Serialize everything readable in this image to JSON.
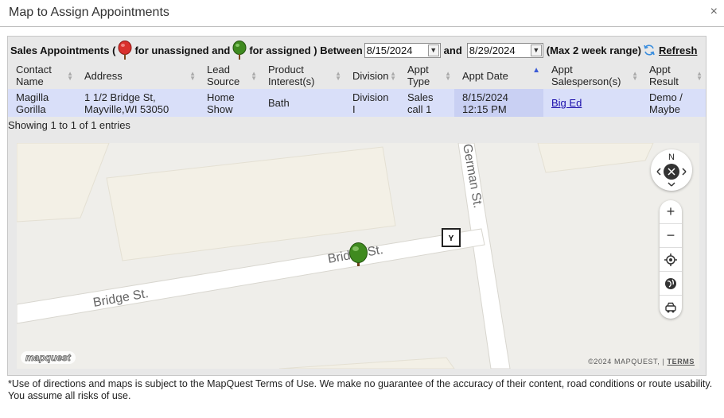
{
  "dialog": {
    "title": "Map to Assign Appointments",
    "close_glyph": "×"
  },
  "toolbar": {
    "label_prefix": "Sales Appointments (",
    "label_unassigned": "for unassigned and",
    "label_assigned": "for assigned ) Between",
    "date_from": "8/15/2024",
    "and_label": "and",
    "date_to": "8/29/2024",
    "max_range_note": "(Max 2 week range)",
    "refresh_label": "Refresh",
    "unassigned_color": "#d9302c",
    "assigned_color": "#3f8a1f"
  },
  "table": {
    "columns": [
      "Contact Name",
      "Address",
      "Lead Source",
      "Product Interest(s)",
      "Division",
      "Appt Type",
      "Appt Date",
      "Appt Salesperson(s)",
      "Appt Result"
    ],
    "columns_wrapped": [
      [
        "Contact",
        "Name"
      ],
      [
        "Address"
      ],
      [
        "Lead",
        "Source"
      ],
      [
        "Product",
        "Interest(s)"
      ],
      [
        "Division"
      ],
      [
        "Appt",
        "Type"
      ],
      [
        "Appt Date"
      ],
      [
        "Appt",
        "Salesperson(s)"
      ],
      [
        "Appt",
        "Result"
      ]
    ],
    "rows": [
      {
        "contact": [
          "Magilla",
          "Gorilla"
        ],
        "address": [
          "1 1/2 Bridge St,",
          "Mayville,WI 53050"
        ],
        "lead_source": [
          "Home",
          "Show"
        ],
        "product": "Bath",
        "division": [
          "Division",
          "I"
        ],
        "appt_type": [
          "Sales",
          "call 1"
        ],
        "appt_date": [
          "8/15/2024",
          "12:15 PM"
        ],
        "salesperson": "Big Ed",
        "result": [
          "Demo /",
          "Maybe"
        ]
      }
    ],
    "row_bg": "#d9dff9",
    "sorted_bg": "#c9d0f3"
  },
  "showing": "Showing 1 to 1 of 1 entries",
  "map": {
    "streets": [
      "German St.",
      "Bridge St.",
      "Bridge St."
    ],
    "provider_logo": "mapquest",
    "copyright": "©2024 MAPQUEST,  |",
    "terms": "TERMS",
    "compass_north": "N",
    "pointer_label": "Y",
    "zoom_in": "+",
    "zoom_out": "−",
    "road_color": "#ffffff",
    "block_color": "#f3f0e6",
    "ground_color": "#efeeea"
  },
  "disclaimer": "*Use of directions and maps is subject to the MapQuest Terms of Use. We make no guarantee of the accuracy of their content, road conditions or route usability. You assume all risks of use."
}
